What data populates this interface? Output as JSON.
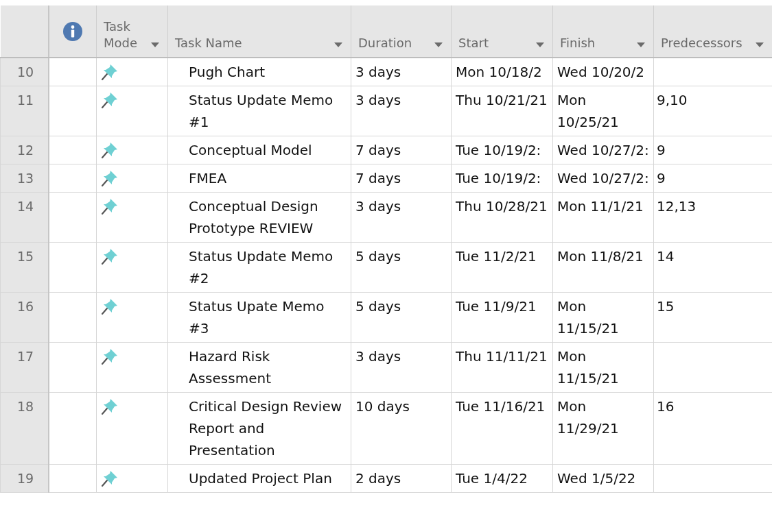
{
  "columns": [
    {
      "label": "Task Mode",
      "dropdown": true
    },
    {
      "label": "Task Name",
      "dropdown": true
    },
    {
      "label": "Duration",
      "dropdown": true
    },
    {
      "label": "Start",
      "dropdown": true
    },
    {
      "label": "Finish",
      "dropdown": true
    },
    {
      "label": "Predecessors",
      "dropdown": true
    }
  ],
  "rows": [
    {
      "id": "10",
      "name": "Pugh Chart",
      "duration": "3 days",
      "start": "Mon 10/18/2",
      "finish": "Wed 10/20/2",
      "predecessors": ""
    },
    {
      "id": "11",
      "name": "Status Update Memo #1",
      "duration": "3 days",
      "start": "Thu 10/21/21",
      "finish": "Mon 10/25/21",
      "predecessors": "9,10"
    },
    {
      "id": "12",
      "name": "Conceptual Model",
      "duration": "7 days",
      "start": "Tue 10/19/2:",
      "finish": "Wed 10/27/2:",
      "predecessors": "9"
    },
    {
      "id": "13",
      "name": "FMEA",
      "duration": "7 days",
      "start": "Tue 10/19/2:",
      "finish": "Wed 10/27/2:",
      "predecessors": "9"
    },
    {
      "id": "14",
      "name": "Conceptual Design Prototype REVIEW",
      "duration": "3 days",
      "start": "Thu 10/28/21",
      "finish": "Mon 11/1/21",
      "predecessors": "12,13"
    },
    {
      "id": "15",
      "name": "Status Update Memo #2",
      "duration": "5 days",
      "start": "Tue 11/2/21",
      "finish": "Mon 11/8/21",
      "predecessors": "14"
    },
    {
      "id": "16",
      "name": "Status Upate Memo #3",
      "duration": "5 days",
      "start": "Tue 11/9/21",
      "finish": "Mon 11/15/21",
      "predecessors": "15"
    },
    {
      "id": "17",
      "name": "Hazard Risk Assessment",
      "duration": "3 days",
      "start": "Thu 11/11/21",
      "finish": "Mon 11/15/21",
      "predecessors": ""
    },
    {
      "id": "18",
      "name": "Critical Design Review Report and Presentation",
      "duration": "10 days",
      "start": "Tue 11/16/21",
      "finish": "Mon 11/29/21",
      "predecessors": "16"
    },
    {
      "id": "19",
      "name": "Updated Project Plan",
      "duration": "2 days",
      "start": "Tue 1/4/22",
      "finish": "Wed 1/5/22",
      "predecessors": ""
    }
  ]
}
